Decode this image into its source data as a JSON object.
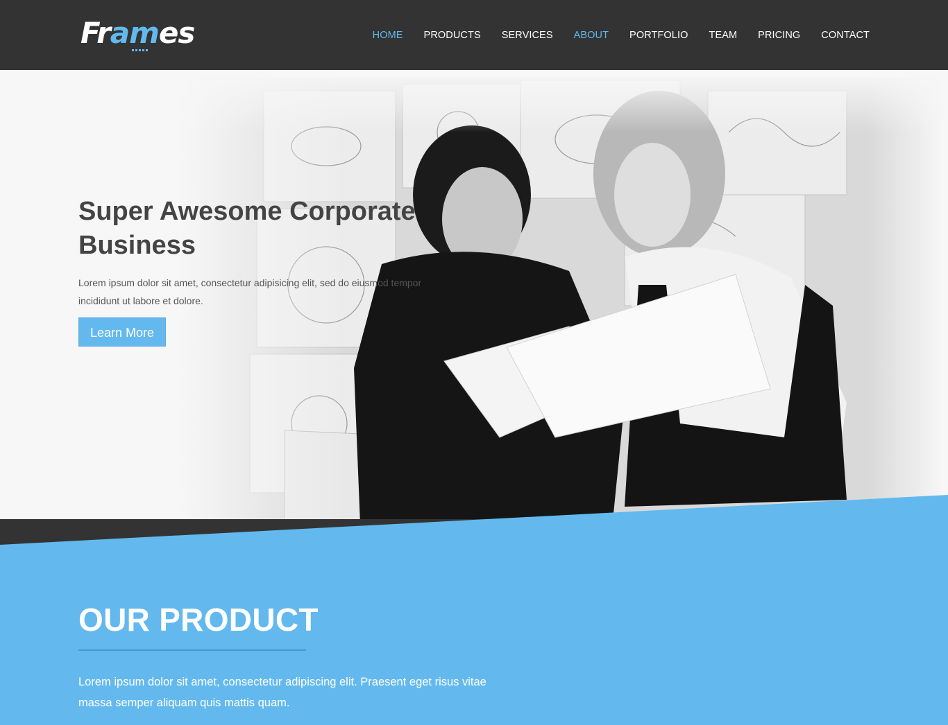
{
  "header": {
    "logo": {
      "part1": "Fr",
      "part2": "am",
      "part3": "es"
    },
    "nav": [
      {
        "label": "HOME",
        "active": true
      },
      {
        "label": "PRODUCTS",
        "active": false
      },
      {
        "label": "SERVICES",
        "active": false
      },
      {
        "label": "ABOUT",
        "active": true
      },
      {
        "label": "PORTFOLIO",
        "active": false
      },
      {
        "label": "TEAM",
        "active": false
      },
      {
        "label": "PRICING",
        "active": false
      },
      {
        "label": "CONTACT",
        "active": false
      }
    ]
  },
  "hero": {
    "title_line1": "Super Awesome Corporate",
    "title_line2": "Business",
    "text": "Lorem ipsum dolor sit amet, consectetur adipisicing elit, sed do eiusmod tempor incididunt ut labore et dolore.",
    "button_label": "Learn More",
    "image_icon": "team-photo-icon"
  },
  "product": {
    "title": "OUR PRODUCT",
    "text": "Lorem ipsum dolor sit amet, consectetur adipiscing elit. Praesent eget risus vitae massa semper aliquam quis mattis quam."
  },
  "colors": {
    "accent": "#63b9ee",
    "header_bg": "#333333",
    "hero_bg": "#f7f7f7",
    "heading": "#444444"
  }
}
